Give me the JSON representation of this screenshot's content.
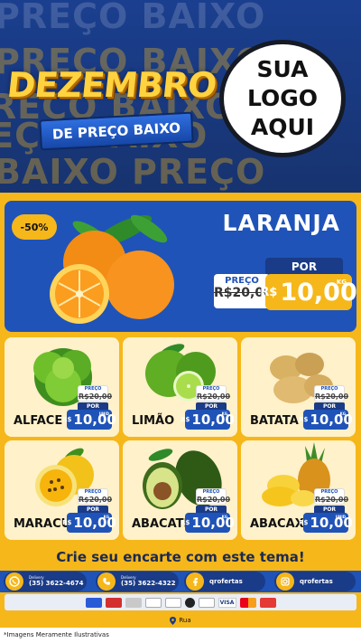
{
  "header": {
    "bg_words": [
      "PREÇO BAIXO",
      "PREÇO BAIXO",
      "PREÇO BAIXO",
      "PREÇO BAIXO",
      "BAIXO PREÇO"
    ],
    "title_main": "DEZEMBRO",
    "title_sub": "DE PREÇO BAIXO",
    "logo_lines": [
      "SUA",
      "LOGO",
      "AQUI"
    ]
  },
  "featured": {
    "discount": "-50%",
    "name": "LARANJA",
    "price_label": "PREÇO",
    "old_price": "R$20,00",
    "por_label": "POR",
    "currency": "R$",
    "new_price": "10,00",
    "unit": "KG"
  },
  "products": [
    {
      "name": "ALFACE",
      "price_label": "PREÇO",
      "old_price": "R$20,00",
      "por_label": "POR",
      "currency": "R$",
      "new_price": "10,00",
      "unit": "UNID"
    },
    {
      "name": "LIMÃO",
      "price_label": "PREÇO",
      "old_price": "R$20,00",
      "por_label": "POR",
      "currency": "R$",
      "new_price": "10,00",
      "unit": "KG"
    },
    {
      "name": "BATATA",
      "price_label": "PREÇO",
      "old_price": "R$20,00",
      "por_label": "POR",
      "currency": "R$",
      "new_price": "10,00",
      "unit": "KG"
    },
    {
      "name": "MARACUJÁ",
      "price_label": "PREÇO",
      "old_price": "R$20,00",
      "por_label": "POR",
      "currency": "R$",
      "new_price": "10,00",
      "unit": "KG"
    },
    {
      "name": "ABACATE",
      "price_label": "PREÇO",
      "old_price": "R$20,00",
      "por_label": "POR",
      "currency": "R$",
      "new_price": "10,00",
      "unit": "KG"
    },
    {
      "name": "ABACAXI",
      "price_label": "PREÇO",
      "old_price": "R$20,00",
      "por_label": "POR",
      "currency": "R$",
      "new_price": "10,00",
      "unit": "UNID"
    }
  ],
  "footer": {
    "cta": "Crie seu encarte com este tema!",
    "contacts": [
      {
        "icon": "whatsapp-icon",
        "small": "Delivery",
        "text": "(35) 3622-4674"
      },
      {
        "icon": "phone-icon",
        "small": "Delivery",
        "text": "(35) 3622-4322"
      },
      {
        "icon": "facebook-icon",
        "small": "",
        "text": "qrofertas"
      },
      {
        "icon": "instagram-icon",
        "small": "",
        "text": "qrofertas"
      }
    ],
    "payment_visa": "VISA",
    "address": "Rua",
    "disclaimer": "*Imagens Meramente Ilustrativas"
  },
  "colors": {
    "blue": "#1f53b8",
    "navy": "#1a3b87",
    "yellow": "#f6b71a",
    "cream": "#fff1c9"
  }
}
